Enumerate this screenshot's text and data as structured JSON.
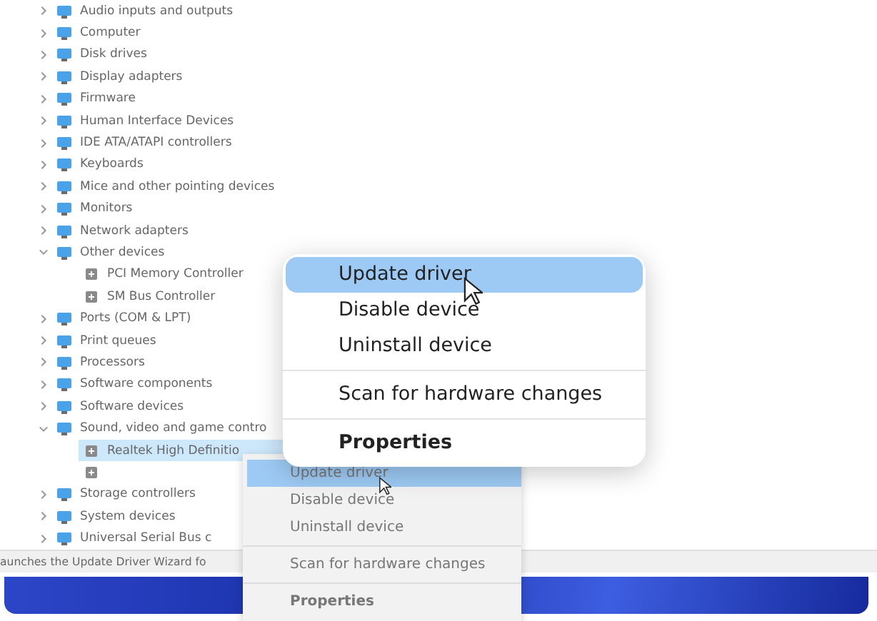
{
  "tree": [
    {
      "label": "Audio inputs and outputs",
      "expanded": false
    },
    {
      "label": "Computer",
      "expanded": false
    },
    {
      "label": "Disk drives",
      "expanded": false
    },
    {
      "label": "Display adapters",
      "expanded": false
    },
    {
      "label": "Firmware",
      "expanded": false
    },
    {
      "label": "Human Interface Devices",
      "expanded": false
    },
    {
      "label": "IDE ATA/ATAPI controllers",
      "expanded": false
    },
    {
      "label": "Keyboards",
      "expanded": false
    },
    {
      "label": "Mice and other pointing devices",
      "expanded": false
    },
    {
      "label": "Monitors",
      "expanded": false
    },
    {
      "label": "Network adapters",
      "expanded": false
    },
    {
      "label": "Other devices",
      "expanded": true,
      "children": [
        {
          "label": "PCI Memory Controller",
          "selected": false
        },
        {
          "label": "SM Bus Controller",
          "selected": false
        }
      ]
    },
    {
      "label": "Ports (COM & LPT)",
      "expanded": false
    },
    {
      "label": "Print queues",
      "expanded": false
    },
    {
      "label": "Processors",
      "expanded": false
    },
    {
      "label": "Software components",
      "expanded": false
    },
    {
      "label": "Software devices",
      "expanded": false
    },
    {
      "label": "Sound, video and game contro",
      "expanded": true,
      "children": [
        {
          "label": "Realtek High Definitio",
          "selected": true
        },
        {
          "selected": false
        }
      ]
    },
    {
      "label": "Storage controllers",
      "expanded": false
    },
    {
      "label": "System devices",
      "expanded": false
    },
    {
      "label": "Universal Serial Bus c",
      "expanded": false
    }
  ],
  "status_bar": "aunches the Update Driver Wizard fo",
  "context_menu": [
    {
      "label": "Update driver",
      "selected": true,
      "kind": "command",
      "separator_before": false
    },
    {
      "label": "Disable device",
      "selected": false,
      "kind": "command",
      "separator_before": false
    },
    {
      "label": "Uninstall device",
      "selected": false,
      "kind": "command",
      "separator_before": false
    },
    {
      "label": "Scan for hardware changes",
      "selected": false,
      "kind": "command",
      "separator_before": true
    },
    {
      "label": "Properties",
      "selected": false,
      "kind": "default",
      "separator_before": true
    }
  ],
  "zoomed_menu": [
    {
      "label": "Update driver",
      "selected": true,
      "kind": "command",
      "separator_before": false
    },
    {
      "label": "Disable device",
      "selected": false,
      "kind": "command",
      "separator_before": false
    },
    {
      "label": "Uninstall device",
      "selected": false,
      "kind": "command",
      "separator_before": false
    },
    {
      "label": "Scan for hardware changes",
      "selected": false,
      "kind": "command",
      "separator_before": true
    },
    {
      "label": "Properties",
      "selected": false,
      "kind": "default",
      "separator_before": true
    }
  ]
}
